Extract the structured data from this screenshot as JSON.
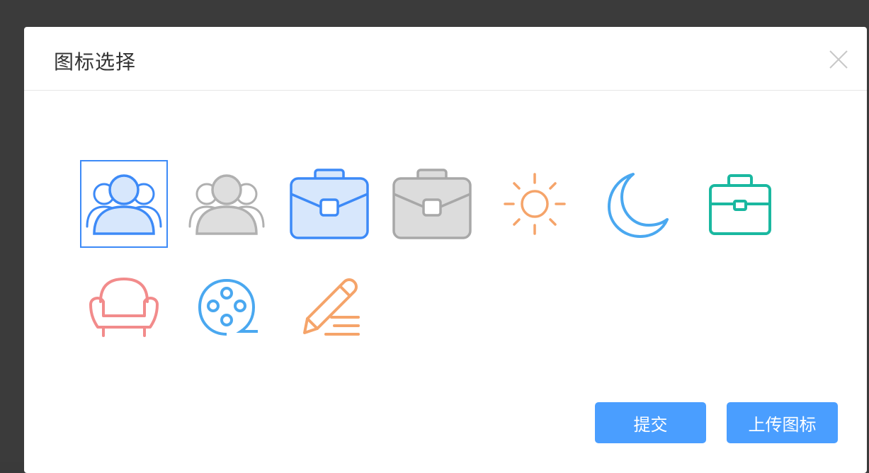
{
  "dialog": {
    "title": "图标选择",
    "close_icon": "close-icon"
  },
  "icons": [
    {
      "name": "users-blue-icon",
      "color": "#3d8af7",
      "selected": true
    },
    {
      "name": "users-gray-icon",
      "color": "#b0b0b0",
      "selected": false
    },
    {
      "name": "briefcase-blue-icon",
      "color": "#3d8af7",
      "selected": false
    },
    {
      "name": "briefcase-gray-icon",
      "color": "#a8a8a8",
      "selected": false
    },
    {
      "name": "sun-icon",
      "color": "#f5a46a",
      "selected": false
    },
    {
      "name": "moon-icon",
      "color": "#4aa8f0",
      "selected": false
    },
    {
      "name": "toolbox-teal-icon",
      "color": "#1ab8a0",
      "selected": false
    },
    {
      "name": "armchair-icon",
      "color": "#f28b8b",
      "selected": false
    },
    {
      "name": "film-reel-icon",
      "color": "#4aa8f0",
      "selected": false
    },
    {
      "name": "pencil-edit-icon",
      "color": "#f5a46a",
      "selected": false
    }
  ],
  "buttons": {
    "submit_label": "提交",
    "upload_label": "上传图标"
  },
  "colors": {
    "accent": "#4a9eff",
    "selected_border": "#3d8af7"
  }
}
